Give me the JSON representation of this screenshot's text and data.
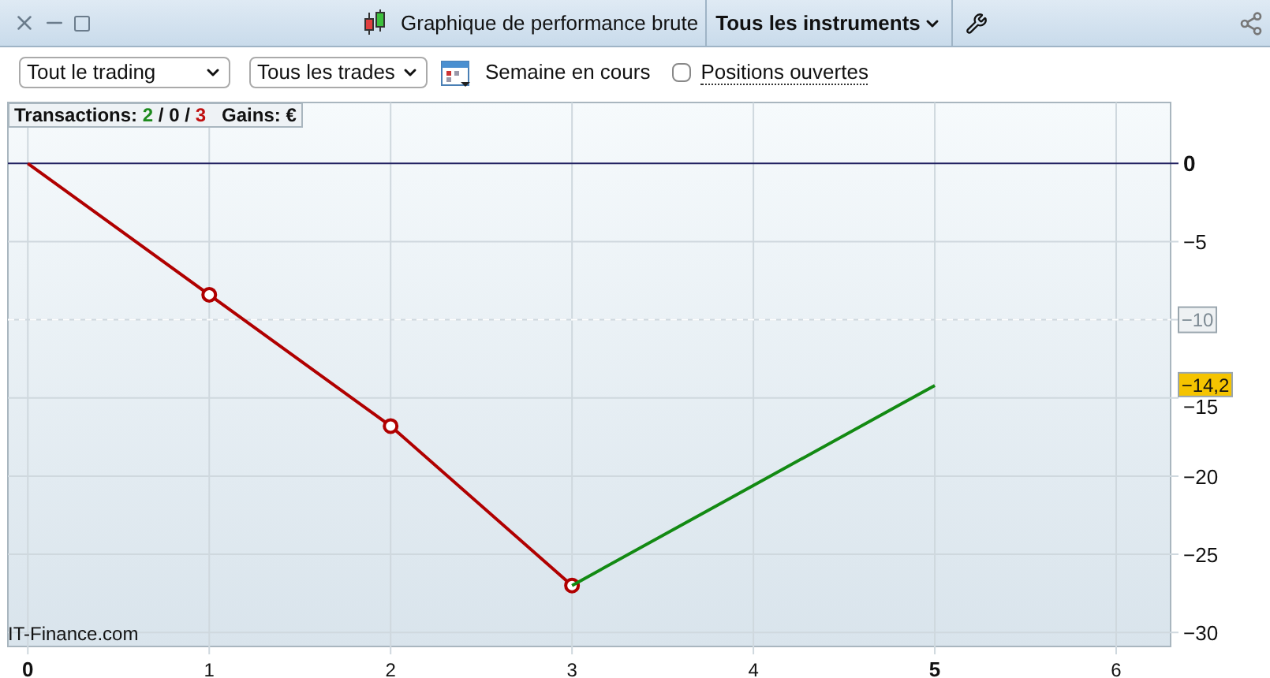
{
  "window": {
    "title": "Graphique de performance brute",
    "instrument_menu": "Tous les instruments"
  },
  "toolbar": {
    "scope_select": "Tout le trading",
    "trades_select": "Tous les trades",
    "period": "Semaine en cours",
    "open_positions": {
      "label": "Positions ouvertes",
      "checked": false
    }
  },
  "summary": {
    "label": "Transactions:",
    "winners": "2",
    "sep1": "/",
    "neutral": "0",
    "sep2": "/",
    "losers": "3",
    "gains_label": "Gains:",
    "gains_value": "€"
  },
  "watermark_text": "IT-Finance.com",
  "chart_data": {
    "type": "line",
    "x": [
      0,
      1,
      2,
      3,
      4,
      5
    ],
    "series": [
      {
        "color": "#b00000",
        "values": [
          0,
          -8.4,
          -16.8,
          -27,
          null,
          null
        ]
      },
      {
        "color": "#138a13",
        "values": [
          null,
          null,
          null,
          -27,
          -20.6,
          -14.2
        ]
      }
    ],
    "xlim": [
      -0.11,
      6.3
    ],
    "ylim": [
      -30.9,
      3.9
    ],
    "grid": true,
    "xticks": [
      0,
      1,
      2,
      3,
      4,
      5,
      6
    ],
    "yticks": [
      {
        "value": 0,
        "label": "0"
      },
      {
        "value": -5,
        "label": "−5"
      },
      {
        "value": -15,
        "label": "−15"
      },
      {
        "value": -20,
        "label": "−20"
      },
      {
        "value": -25,
        "label": "−25"
      },
      {
        "value": -30,
        "label": "−30"
      }
    ],
    "ref_lines": [
      {
        "axis": "y",
        "value": -10,
        "label": "−10",
        "color": "#ffffff"
      }
    ],
    "annotations": [
      "−14,2"
    ]
  }
}
